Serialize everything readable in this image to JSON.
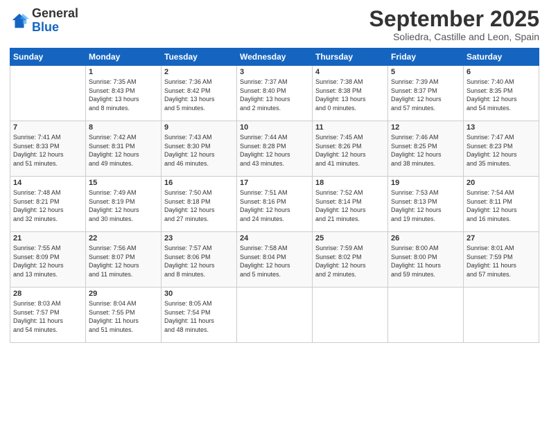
{
  "header": {
    "logo_general": "General",
    "logo_blue": "Blue",
    "month_title": "September 2025",
    "subtitle": "Soliedra, Castille and Leon, Spain"
  },
  "days_of_week": [
    "Sunday",
    "Monday",
    "Tuesday",
    "Wednesday",
    "Thursday",
    "Friday",
    "Saturday"
  ],
  "weeks": [
    [
      {
        "day": "",
        "info": ""
      },
      {
        "day": "1",
        "info": "Sunrise: 7:35 AM\nSunset: 8:43 PM\nDaylight: 13 hours\nand 8 minutes."
      },
      {
        "day": "2",
        "info": "Sunrise: 7:36 AM\nSunset: 8:42 PM\nDaylight: 13 hours\nand 5 minutes."
      },
      {
        "day": "3",
        "info": "Sunrise: 7:37 AM\nSunset: 8:40 PM\nDaylight: 13 hours\nand 2 minutes."
      },
      {
        "day": "4",
        "info": "Sunrise: 7:38 AM\nSunset: 8:38 PM\nDaylight: 13 hours\nand 0 minutes."
      },
      {
        "day": "5",
        "info": "Sunrise: 7:39 AM\nSunset: 8:37 PM\nDaylight: 12 hours\nand 57 minutes."
      },
      {
        "day": "6",
        "info": "Sunrise: 7:40 AM\nSunset: 8:35 PM\nDaylight: 12 hours\nand 54 minutes."
      }
    ],
    [
      {
        "day": "7",
        "info": "Sunrise: 7:41 AM\nSunset: 8:33 PM\nDaylight: 12 hours\nand 51 minutes."
      },
      {
        "day": "8",
        "info": "Sunrise: 7:42 AM\nSunset: 8:31 PM\nDaylight: 12 hours\nand 49 minutes."
      },
      {
        "day": "9",
        "info": "Sunrise: 7:43 AM\nSunset: 8:30 PM\nDaylight: 12 hours\nand 46 minutes."
      },
      {
        "day": "10",
        "info": "Sunrise: 7:44 AM\nSunset: 8:28 PM\nDaylight: 12 hours\nand 43 minutes."
      },
      {
        "day": "11",
        "info": "Sunrise: 7:45 AM\nSunset: 8:26 PM\nDaylight: 12 hours\nand 41 minutes."
      },
      {
        "day": "12",
        "info": "Sunrise: 7:46 AM\nSunset: 8:25 PM\nDaylight: 12 hours\nand 38 minutes."
      },
      {
        "day": "13",
        "info": "Sunrise: 7:47 AM\nSunset: 8:23 PM\nDaylight: 12 hours\nand 35 minutes."
      }
    ],
    [
      {
        "day": "14",
        "info": "Sunrise: 7:48 AM\nSunset: 8:21 PM\nDaylight: 12 hours\nand 32 minutes."
      },
      {
        "day": "15",
        "info": "Sunrise: 7:49 AM\nSunset: 8:19 PM\nDaylight: 12 hours\nand 30 minutes."
      },
      {
        "day": "16",
        "info": "Sunrise: 7:50 AM\nSunset: 8:18 PM\nDaylight: 12 hours\nand 27 minutes."
      },
      {
        "day": "17",
        "info": "Sunrise: 7:51 AM\nSunset: 8:16 PM\nDaylight: 12 hours\nand 24 minutes."
      },
      {
        "day": "18",
        "info": "Sunrise: 7:52 AM\nSunset: 8:14 PM\nDaylight: 12 hours\nand 21 minutes."
      },
      {
        "day": "19",
        "info": "Sunrise: 7:53 AM\nSunset: 8:13 PM\nDaylight: 12 hours\nand 19 minutes."
      },
      {
        "day": "20",
        "info": "Sunrise: 7:54 AM\nSunset: 8:11 PM\nDaylight: 12 hours\nand 16 minutes."
      }
    ],
    [
      {
        "day": "21",
        "info": "Sunrise: 7:55 AM\nSunset: 8:09 PM\nDaylight: 12 hours\nand 13 minutes."
      },
      {
        "day": "22",
        "info": "Sunrise: 7:56 AM\nSunset: 8:07 PM\nDaylight: 12 hours\nand 11 minutes."
      },
      {
        "day": "23",
        "info": "Sunrise: 7:57 AM\nSunset: 8:06 PM\nDaylight: 12 hours\nand 8 minutes."
      },
      {
        "day": "24",
        "info": "Sunrise: 7:58 AM\nSunset: 8:04 PM\nDaylight: 12 hours\nand 5 minutes."
      },
      {
        "day": "25",
        "info": "Sunrise: 7:59 AM\nSunset: 8:02 PM\nDaylight: 12 hours\nand 2 minutes."
      },
      {
        "day": "26",
        "info": "Sunrise: 8:00 AM\nSunset: 8:00 PM\nDaylight: 11 hours\nand 59 minutes."
      },
      {
        "day": "27",
        "info": "Sunrise: 8:01 AM\nSunset: 7:59 PM\nDaylight: 11 hours\nand 57 minutes."
      }
    ],
    [
      {
        "day": "28",
        "info": "Sunrise: 8:03 AM\nSunset: 7:57 PM\nDaylight: 11 hours\nand 54 minutes."
      },
      {
        "day": "29",
        "info": "Sunrise: 8:04 AM\nSunset: 7:55 PM\nDaylight: 11 hours\nand 51 minutes."
      },
      {
        "day": "30",
        "info": "Sunrise: 8:05 AM\nSunset: 7:54 PM\nDaylight: 11 hours\nand 48 minutes."
      },
      {
        "day": "",
        "info": ""
      },
      {
        "day": "",
        "info": ""
      },
      {
        "day": "",
        "info": ""
      },
      {
        "day": "",
        "info": ""
      }
    ]
  ]
}
